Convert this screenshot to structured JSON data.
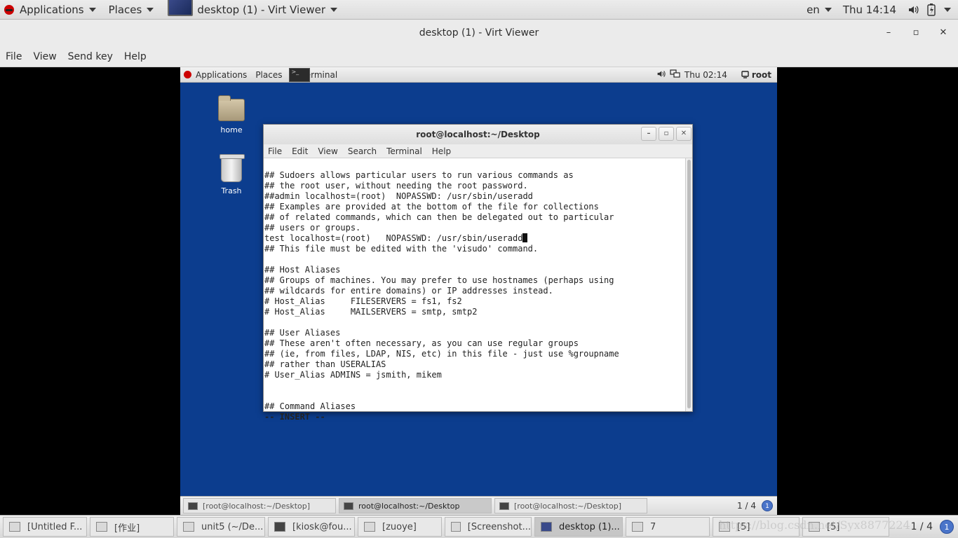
{
  "host_panel": {
    "applications": "Applications",
    "places": "Places",
    "window_title": "desktop (1) - Virt Viewer",
    "keyboard": "en",
    "clock": "Thu 14:14"
  },
  "viewer": {
    "title": "desktop (1) - Virt Viewer",
    "minimize": "–",
    "maximize": "▫",
    "close": "✕",
    "menu": [
      "File",
      "View",
      "Send key",
      "Help"
    ]
  },
  "guest_panel": {
    "applications": "Applications",
    "places": "Places",
    "terminal": "Terminal",
    "clock": "Thu 02:14",
    "user": "root"
  },
  "desktop_icons": {
    "home": "home",
    "trash": "Trash"
  },
  "terminal": {
    "title": "root@localhost:~/Desktop",
    "menu": [
      "File",
      "Edit",
      "View",
      "Search",
      "Terminal",
      "Help"
    ],
    "lines": [
      "## Sudoers allows particular users to run various commands as",
      "## the root user, without needing the root password.",
      "##admin localhost=(root)  NOPASSWD: /usr/sbin/useradd",
      "## Examples are provided at the bottom of the file for collections",
      "## of related commands, which can then be delegated out to particular",
      "## users or groups.",
      "test localhost=(root)   NOPASSWD: /usr/sbin/useradd",
      "## This file must be edited with the 'visudo' command.",
      "",
      "## Host Aliases",
      "## Groups of machines. You may prefer to use hostnames (perhaps using",
      "## wildcards for entire domains) or IP addresses instead.",
      "# Host_Alias     FILESERVERS = fs1, fs2",
      "# Host_Alias     MAILSERVERS = smtp, smtp2",
      "",
      "## User Aliases",
      "## These aren't often necessary, as you can use regular groups",
      "## (ie, from files, LDAP, NIS, etc) in this file - just use %groupname",
      "## rather than USERALIAS",
      "# User_Alias ADMINS = jsmith, mikem",
      "",
      "",
      "## Command Aliases"
    ],
    "status_line": "-- INSERT --"
  },
  "guest_taskbar": {
    "tasks": [
      {
        "label": "[root@localhost:~/Desktop]"
      },
      {
        "label": "root@localhost:~/Desktop"
      },
      {
        "label": "[root@localhost:~/Desktop]"
      }
    ],
    "workspace": "1 / 4",
    "workspace_badge": "1"
  },
  "host_taskbar": {
    "tasks": [
      {
        "label": "[Untitled F..."
      },
      {
        "label": "[作业]"
      },
      {
        "label": "unit5 (~/De..."
      },
      {
        "label": "[kiosk@fou..."
      },
      {
        "label": "[zuoye]"
      },
      {
        "label": "[Screenshot..."
      },
      {
        "label": "desktop (1)..."
      },
      {
        "label": "7"
      },
      {
        "label": "[5]"
      },
      {
        "label": "[5]"
      }
    ],
    "workspace": "1 / 4",
    "workspace_badge": "1",
    "watermark": "https://blog.csdn.net/Syx8877224"
  }
}
